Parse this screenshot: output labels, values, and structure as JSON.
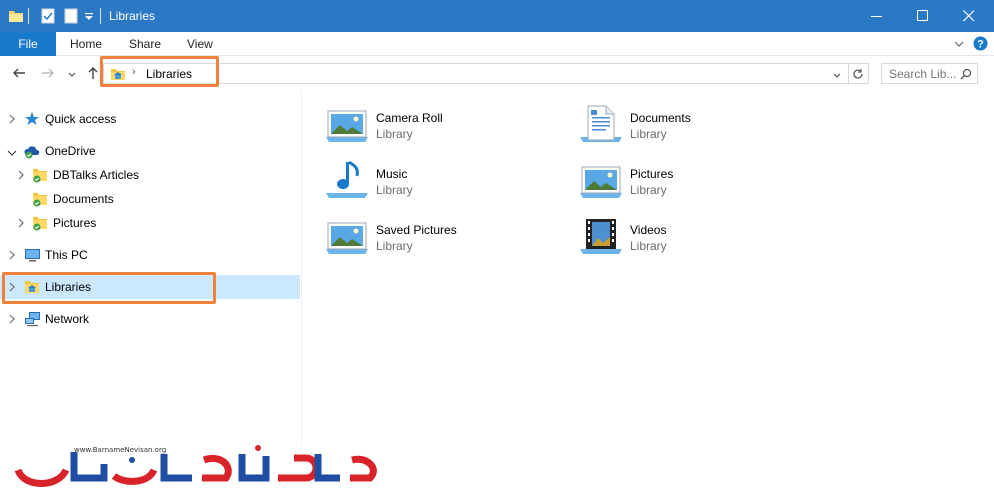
{
  "window": {
    "title": "Libraries"
  },
  "ribbon": {
    "tabs": [
      "File",
      "Home",
      "Share",
      "View"
    ]
  },
  "address": {
    "crumbs": [
      "Libraries"
    ],
    "search_placeholder": "Search Lib..."
  },
  "nav": {
    "items": [
      {
        "label": "Quick access",
        "icon": "star-icon"
      },
      {
        "label": "OneDrive",
        "icon": "onedrive-cloud-icon"
      },
      {
        "label": "DBTalks Articles",
        "icon": "synced-folder-icon"
      },
      {
        "label": "Documents",
        "icon": "synced-folder-icon"
      },
      {
        "label": "Pictures",
        "icon": "synced-folder-icon"
      },
      {
        "label": "This PC",
        "icon": "computer-icon"
      },
      {
        "label": "Libraries",
        "icon": "libraries-icon"
      },
      {
        "label": "Network",
        "icon": "network-icon"
      }
    ]
  },
  "libraries": [
    {
      "name": "Camera Roll",
      "type": "Library",
      "icon": "camera-roll-library-icon"
    },
    {
      "name": "Documents",
      "type": "Library",
      "icon": "documents-library-icon"
    },
    {
      "name": "Music",
      "type": "Library",
      "icon": "music-library-icon"
    },
    {
      "name": "Pictures",
      "type": "Library",
      "icon": "pictures-library-icon"
    },
    {
      "name": "Saved Pictures",
      "type": "Library",
      "icon": "saved-pictures-library-icon"
    },
    {
      "name": "Videos",
      "type": "Library",
      "icon": "videos-library-icon"
    }
  ],
  "watermark": {
    "url": "www.BarnameNevisan.org"
  },
  "colors": {
    "titlebar": "#2b78c4",
    "file_tab": "#1979ca",
    "selection": "#cce8ff",
    "highlight": "#f0803c",
    "logo_red": "#d8232a",
    "logo_blue": "#1f4ea3"
  }
}
